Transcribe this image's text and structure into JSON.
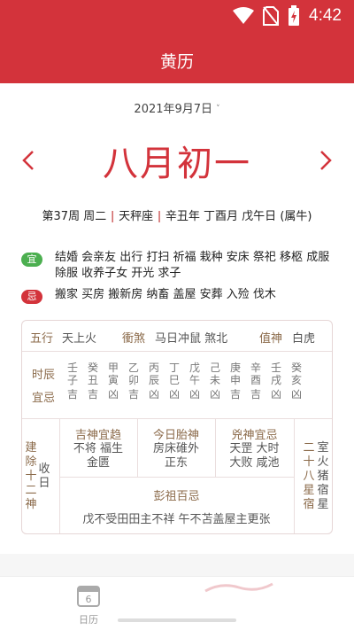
{
  "status": {
    "time": "4:42",
    "wifi_icon": "wifi-icon",
    "sim_icon": "no-sim-icon",
    "battery_icon": "battery-charging-icon"
  },
  "appbar": {
    "title": "黄历"
  },
  "date": {
    "solar": "2021年9月7日",
    "lunar": "八月初一",
    "chevron": "˅"
  },
  "info": {
    "week": "第37周 周二",
    "star_sign": "天秤座",
    "ganzhi": "辛丑年 丁酉月 戊午日 (属牛)"
  },
  "yi": {
    "badge": "宜",
    "text": "结婚 会亲友 出行 打扫 祈福 栽种 安床 祭祀 移柩 成服 除服 收养子女 开光 求子"
  },
  "ji": {
    "badge": "忌",
    "text": "搬家 买房 搬新房 纳畜 盖屋 安葬 入殓 伐木"
  },
  "table": {
    "wuxing_label": "五行",
    "wuxing_value": "天上火",
    "chongsha_label": "衝煞",
    "chongsha_value": "马日冲鼠 煞北",
    "zhishen_label": "值神",
    "zhishen_value": "白虎",
    "shichen_label": "时辰",
    "yiji_label": "宜忌",
    "shichen": [
      {
        "gan": "壬",
        "zhi": "子",
        "yj": "吉"
      },
      {
        "gan": "癸",
        "zhi": "丑",
        "yj": "吉"
      },
      {
        "gan": "甲",
        "zhi": "寅",
        "yj": "凶"
      },
      {
        "gan": "乙",
        "zhi": "卯",
        "yj": "吉"
      },
      {
        "gan": "丙",
        "zhi": "辰",
        "yj": "凶"
      },
      {
        "gan": "丁",
        "zhi": "巳",
        "yj": "凶"
      },
      {
        "gan": "戊",
        "zhi": "午",
        "yj": "凶"
      },
      {
        "gan": "己",
        "zhi": "未",
        "yj": "凶"
      },
      {
        "gan": "庚",
        "zhi": "申",
        "yj": "吉"
      },
      {
        "gan": "辛",
        "zhi": "酉",
        "yj": "吉"
      },
      {
        "gan": "壬",
        "zhi": "戌",
        "yj": "凶"
      },
      {
        "gan": "癸",
        "zhi": "亥",
        "yj": "凶"
      }
    ],
    "jianchu_label": "建除十二神",
    "jianchu_value": "收日",
    "jishen_label": "吉神宜趋",
    "jishen_value": "不将 福生 金匮",
    "taishen_label": "今日胎神",
    "taishen_value": "房床碓外 正东",
    "xiongshen_label": "兇神宜忌",
    "xiongshen_value": "天罡 大时 大败 咸池",
    "xiu_label": "二十八星宿",
    "xiu_value": "室火猪宿星",
    "pengzu_label": "彭祖百忌",
    "pengzu_value": "戊不受田田主不祥 午不苫盖屋主更张"
  },
  "tabbar": {
    "calendar_day": "6",
    "calendar_label": "日历"
  }
}
